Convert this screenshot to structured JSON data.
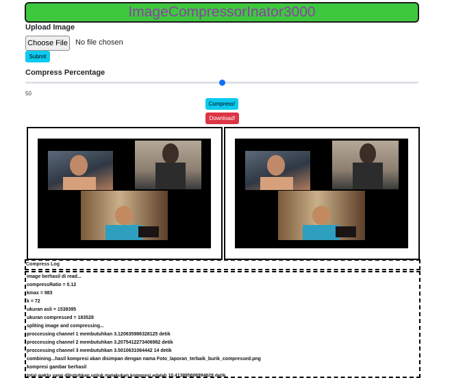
{
  "app": {
    "title": "ImageCompressorInator3000"
  },
  "upload": {
    "label": "Upload Image",
    "choose_label": "Choose File",
    "file_status": "No file chosen",
    "submit_label": "Submit"
  },
  "compress": {
    "label": "Compress Percentage",
    "value": "50",
    "range_fraction": 0.5,
    "compress_label": "Compress!",
    "download_label": "Download!"
  },
  "previews": {
    "original": {
      "tiles": [
        "person-top-left",
        "person-top-right",
        "person-bottom"
      ]
    },
    "compressed": {
      "tiles": [
        "person-top-left",
        "person-top-right",
        "person-bottom"
      ]
    }
  },
  "log": {
    "header": "Compress Log",
    "lines": [
      "image berhasil di read...",
      "compressRatio = 0.12",
      "kmax = 983",
      "k = 72",
      "ukuran asli = 1538395",
      "ukuran compressed = 183528",
      "spliting image and compressing...",
      "proccessing channel 1 membutuhkan 3.120635986328125 detik",
      "proccessing channel 2 membutuhkan 3.2075412273406982 detik",
      "proccessing channel 3 membutuhkan 3.5010631084442 14 detik",
      "combining...hasil kompresi akan disimpan dengan nama Foto_laporan_terbaik_burik_compressed.png",
      "kompresi gambar berhasil",
      "total waktu yang dibutuhkan untuk melakukan kompresi adalah 10.413895606994629 detik"
    ]
  },
  "colors": {
    "header_bg": "#3ec83e",
    "header_text": "#8e3fa6",
    "info": "#0dcaf0",
    "danger": "#dc3545",
    "slider": "#0d6efd"
  }
}
